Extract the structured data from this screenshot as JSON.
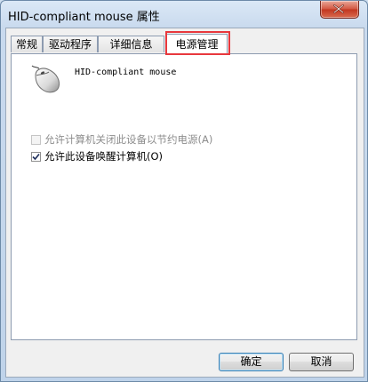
{
  "window": {
    "title": "HID-compliant mouse 属性"
  },
  "tabs": [
    {
      "label": "常规"
    },
    {
      "label": "驱动程序"
    },
    {
      "label": "详细信息"
    },
    {
      "label": "电源管理",
      "active": true
    }
  ],
  "device": {
    "name": "HID-compliant mouse",
    "icon": "mouse-icon"
  },
  "options": {
    "allow_power_off": {
      "label": "允许计算机关闭此设备以节约电源(A)",
      "checked": false,
      "enabled": false
    },
    "allow_wake": {
      "label": "允许此设备唤醒计算机(O)",
      "checked": true,
      "enabled": true
    }
  },
  "buttons": {
    "ok": "确定",
    "cancel": "取消"
  },
  "colors": {
    "highlight": "#e8383d",
    "close_button": "#c2351f"
  }
}
